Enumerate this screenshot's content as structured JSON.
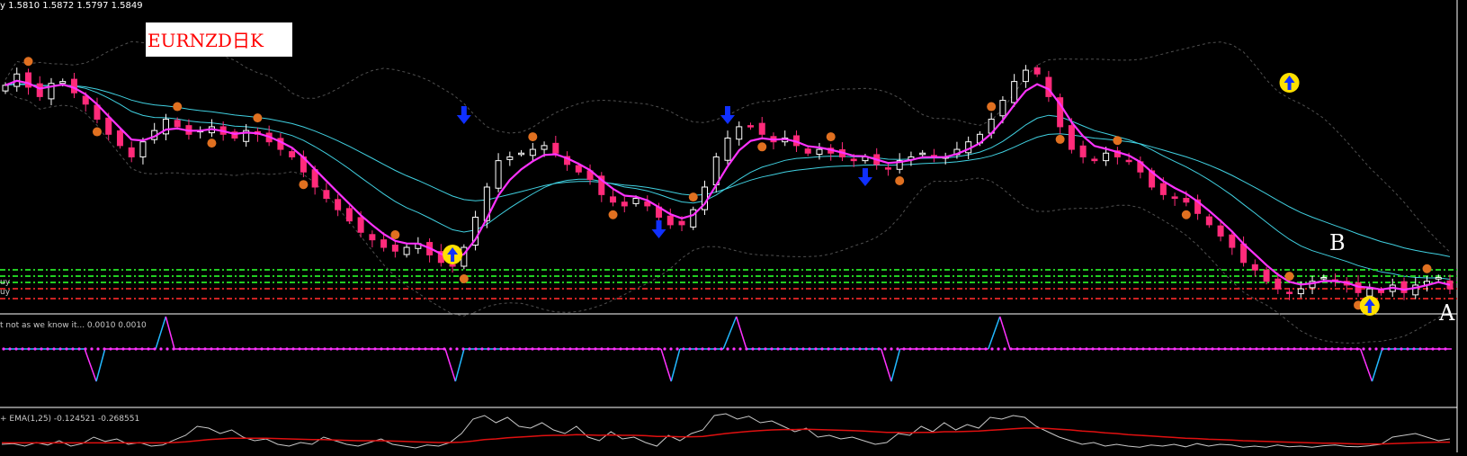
{
  "header": {
    "ohlc": "y   1.5810 1.5872 1.5797 1.5849",
    "title": "EURNZD日K",
    "left_labels": [
      "uy",
      "uy"
    ]
  },
  "annotations": {
    "point_b": "B",
    "point_a": "A"
  },
  "panels": {
    "indicator1": {
      "label": "t not as we know it...  0.0010 0.0010"
    },
    "indicator2": {
      "label": "+ EMA(1,25) -0.124521 -0.268551"
    }
  },
  "colors": {
    "background": "#000000",
    "bull_candle": "#ffffff",
    "bear_candle": "#ff2b7a",
    "ma_fast": "#ff32ff",
    "ma_slow": "#40d0e0",
    "bands": "#505050",
    "indicator1_up": "#22b8ff",
    "indicator1_down": "#ff32ff",
    "osc_line": "#c8c8c8",
    "osc_ema": "#e01010",
    "levels_green": "#22cc22",
    "levels_red": "#cc2222",
    "buy_arrow": "#ffe000",
    "sell_arrow": "#1030ff",
    "small_marker": "#e07020"
  },
  "chart_data": [
    {
      "type": "candlestick",
      "title": "EURNZD日K",
      "close": [
        1.599,
        1.602,
        1.5985,
        1.596,
        1.5995,
        1.6,
        1.597,
        1.594,
        1.59,
        1.586,
        1.583,
        1.58,
        1.584,
        1.587,
        1.59,
        1.588,
        1.586,
        1.587,
        1.588,
        1.586,
        1.585,
        1.587,
        1.586,
        1.584,
        1.582,
        1.58,
        1.576,
        1.572,
        1.569,
        1.566,
        1.563,
        1.56,
        1.558,
        1.556,
        1.555,
        1.556,
        1.557,
        1.554,
        1.552,
        1.551,
        1.556,
        1.564,
        1.572,
        1.579,
        1.58,
        1.581,
        1.582,
        1.583,
        1.581,
        1.578,
        1.576,
        1.574,
        1.57,
        1.568,
        1.567,
        1.569,
        1.567,
        1.564,
        1.562,
        1.562,
        1.566,
        1.572,
        1.58,
        1.585,
        1.588,
        1.588,
        1.586,
        1.584,
        1.585,
        1.583,
        1.581,
        1.582,
        1.581,
        1.58,
        1.579,
        1.58,
        1.578,
        1.577,
        1.579,
        1.58,
        1.581,
        1.58,
        1.58,
        1.582,
        1.584,
        1.586,
        1.59,
        1.595,
        1.6,
        1.603,
        1.602,
        1.596,
        1.588,
        1.582,
        1.58,
        1.579,
        1.581,
        1.58,
        1.579,
        1.576,
        1.572,
        1.57,
        1.569,
        1.568,
        1.565,
        1.562,
        1.559,
        1.556,
        1.552,
        1.55,
        1.547,
        1.545,
        1.544,
        1.545,
        1.547,
        1.548,
        1.547,
        1.546,
        1.544,
        1.545,
        1.544,
        1.546,
        1.544,
        1.546,
        1.547,
        1.548,
        1.545
      ]
    },
    {
      "type": "line",
      "label": "t not as we know it...  0.0010 0.0010",
      "segments": [
        {
          "type": "dip",
          "start": 0.056,
          "bottom": 0.064,
          "rise": 0.07,
          "flat_to": 0.105
        },
        {
          "type": "spike",
          "start": 0.105,
          "peak": 0.112,
          "end": 0.118
        },
        {
          "type": "dip",
          "start": 0.305,
          "bottom": 0.312,
          "rise": 0.318,
          "flat_to": 0.344
        },
        {
          "type": "dip",
          "start": 0.454,
          "bottom": 0.461,
          "rise": 0.467,
          "flat_to": 0.497
        },
        {
          "type": "spike",
          "start": 0.497,
          "peak": 0.506,
          "end": 0.513
        },
        {
          "type": "dip",
          "start": 0.606,
          "bottom": 0.613,
          "rise": 0.619,
          "flat_to": 0.68
        },
        {
          "type": "spike",
          "start": 0.68,
          "peak": 0.688,
          "end": 0.695
        },
        {
          "type": "dip",
          "start": 0.937,
          "bottom": 0.945,
          "rise": 0.952,
          "flat_to": 0.98
        }
      ]
    },
    {
      "type": "line",
      "label": "+ EMA(1,25) -0.124521 -0.268551",
      "osc": [
        0.1,
        0.12,
        0.05,
        0.15,
        0.08,
        0.2,
        0.05,
        0.12,
        0.3,
        0.18,
        0.25,
        0.1,
        0.15,
        0.05,
        0.08,
        0.22,
        0.35,
        0.6,
        0.55,
        0.4,
        0.5,
        0.3,
        0.2,
        0.25,
        0.1,
        0.05,
        0.15,
        0.1,
        0.3,
        0.2,
        0.1,
        0.05,
        0.15,
        0.25,
        0.1,
        0.05,
        0.0,
        0.08,
        0.05,
        0.15,
        0.4,
        0.8,
        0.9,
        0.7,
        0.85,
        0.6,
        0.55,
        0.7,
        0.5,
        0.4,
        0.6,
        0.3,
        0.2,
        0.45,
        0.25,
        0.3,
        0.15,
        0.05,
        0.35,
        0.2,
        0.4,
        0.5,
        0.9,
        0.95,
        0.8,
        0.88,
        0.7,
        0.75,
        0.6,
        0.45,
        0.55,
        0.3,
        0.35,
        0.25,
        0.3,
        0.2,
        0.1,
        0.15,
        0.4,
        0.35,
        0.6,
        0.45,
        0.7,
        0.5,
        0.65,
        0.55,
        0.85,
        0.8,
        0.9,
        0.85,
        0.6,
        0.45,
        0.3,
        0.2,
        0.1,
        0.15,
        0.05,
        0.1,
        0.05,
        0.02,
        0.08,
        0.05,
        0.1,
        0.03,
        0.12,
        0.05,
        0.1,
        0.08,
        0.02,
        0.05,
        0.02,
        0.08,
        0.03,
        0.05,
        0.02,
        0.06,
        0.08,
        0.04,
        0.03,
        0.06,
        0.1,
        0.3,
        0.35,
        0.4,
        0.3,
        0.2,
        0.25
      ],
      "ema": [
        0.14,
        0.14,
        0.14,
        0.14,
        0.14,
        0.14,
        0.14,
        0.14,
        0.14,
        0.14,
        0.14,
        0.14,
        0.14,
        0.14,
        0.14,
        0.15,
        0.17,
        0.2,
        0.23,
        0.25,
        0.27,
        0.27,
        0.27,
        0.27,
        0.26,
        0.25,
        0.24,
        0.23,
        0.23,
        0.22,
        0.21,
        0.2,
        0.2,
        0.2,
        0.19,
        0.18,
        0.17,
        0.16,
        0.15,
        0.15,
        0.16,
        0.19,
        0.23,
        0.25,
        0.28,
        0.3,
        0.32,
        0.34,
        0.35,
        0.35,
        0.37,
        0.36,
        0.35,
        0.36,
        0.35,
        0.35,
        0.34,
        0.32,
        0.32,
        0.31,
        0.31,
        0.32,
        0.36,
        0.4,
        0.43,
        0.46,
        0.48,
        0.5,
        0.51,
        0.51,
        0.52,
        0.51,
        0.5,
        0.49,
        0.48,
        0.47,
        0.45,
        0.43,
        0.43,
        0.42,
        0.43,
        0.43,
        0.45,
        0.45,
        0.46,
        0.47,
        0.49,
        0.51,
        0.53,
        0.55,
        0.55,
        0.54,
        0.52,
        0.5,
        0.47,
        0.45,
        0.42,
        0.4,
        0.37,
        0.35,
        0.33,
        0.31,
        0.29,
        0.27,
        0.26,
        0.24,
        0.23,
        0.22,
        0.2,
        0.19,
        0.18,
        0.17,
        0.16,
        0.15,
        0.14,
        0.13,
        0.13,
        0.12,
        0.11,
        0.11,
        0.11,
        0.12,
        0.13,
        0.14,
        0.15,
        0.16,
        0.16
      ]
    }
  ]
}
